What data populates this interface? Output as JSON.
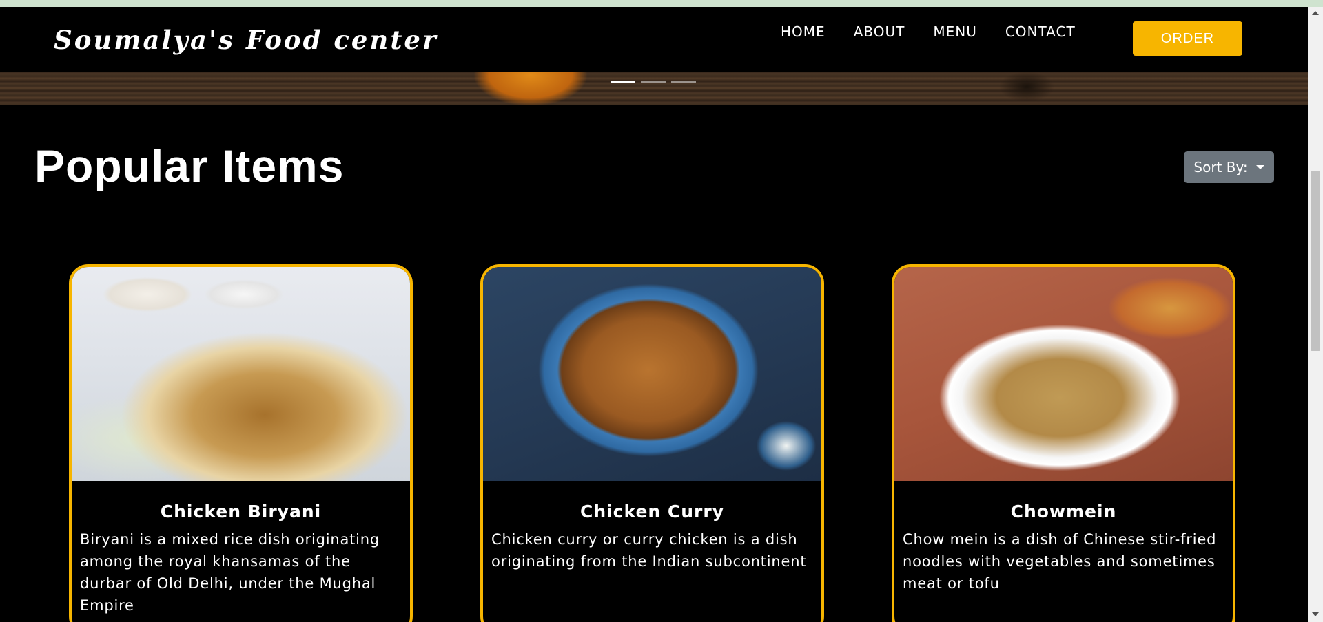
{
  "navbar": {
    "brand": "Soumalya's Food center",
    "links": [
      "HOME",
      "ABOUT",
      "MENU",
      "CONTACT"
    ],
    "order_label": "ORDER",
    "order_color": "#f7b500"
  },
  "carousel": {
    "slide_count": 3,
    "active_index": 0
  },
  "section": {
    "title": "Popular Items",
    "sort_label": "Sort By:"
  },
  "cards": [
    {
      "title": "Chicken Biryani",
      "description": "Biryani is a mixed rice dish originating among the royal khansamas of the durbar of Old Delhi, under the Mughal Empire",
      "image_alt": "chicken biryani photo"
    },
    {
      "title": "Chicken Curry",
      "description": "Chicken curry or curry chicken is a dish originating from the Indian subcontinent",
      "image_alt": "chicken curry photo"
    },
    {
      "title": "Chowmein",
      "description": "Chow mein is a dish of Chinese stir-fried noodles with vegetables and sometimes meat or tofu",
      "image_alt": "chowmein photo"
    }
  ],
  "colors": {
    "accent": "#f7b500",
    "background": "#000000",
    "sort_button": "#6c757d"
  }
}
